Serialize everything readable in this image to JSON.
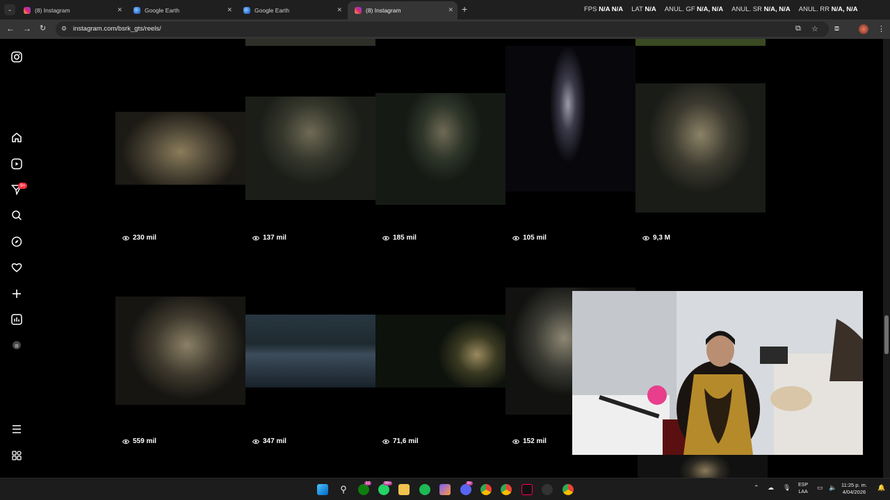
{
  "browser": {
    "tabs": [
      {
        "title": "(8) Instagram",
        "icon": "instagram-icon"
      },
      {
        "title": "Google Earth",
        "icon": "google-earth-icon"
      },
      {
        "title": "Google Earth",
        "icon": "google-earth-icon"
      },
      {
        "title": "(8) Instagram",
        "icon": "instagram-icon",
        "active": true
      }
    ],
    "url": "instagram.com/bsrk_gts/reels/"
  },
  "stream_overlay": {
    "items": [
      {
        "label": "FPS",
        "value": "N/A  N/A"
      },
      {
        "label": "LAT",
        "value": "N/A"
      },
      {
        "label": "ANUL. GF",
        "value": "N/A, N/A"
      },
      {
        "label": "ANUL. SR",
        "value": "N/A, N/A"
      },
      {
        "label": "ANUL. RR",
        "value": "N/A, N/A"
      }
    ]
  },
  "sidebar": {
    "items": [
      {
        "name": "instagram-logo-icon"
      },
      {
        "name": "home-icon"
      },
      {
        "name": "reels-icon"
      },
      {
        "name": "messages-icon",
        "badge": "9+"
      },
      {
        "name": "search-icon"
      },
      {
        "name": "explore-icon"
      },
      {
        "name": "notifications-icon"
      },
      {
        "name": "create-icon"
      },
      {
        "name": "dashboard-icon"
      },
      {
        "name": "profile-avatar"
      },
      {
        "name": "more-menu-icon"
      },
      {
        "name": "also-from-meta-icon"
      }
    ]
  },
  "reels": [
    {
      "views": "230 mil"
    },
    {
      "views": "137 mil"
    },
    {
      "views": "185 mil"
    },
    {
      "views": "105 mil"
    },
    {
      "views": "9,3 M"
    },
    {
      "views": "559 mil"
    },
    {
      "views": "347 mil"
    },
    {
      "views": "71,6 mil"
    },
    {
      "views": "152 mil"
    }
  ],
  "taskbar": {
    "badges": {
      "xbox": "12",
      "whatsapp": "99+",
      "discord": "9+"
    },
    "language": {
      "top": "ESP",
      "bottom": "LAA"
    },
    "clock": {
      "time": "11:25 p. m.",
      "date": "4/04/2026"
    }
  },
  "colors": {
    "instagram_badge": "#ff3040",
    "tab_bar": "#1f1f1f",
    "toolbar": "#353535"
  }
}
